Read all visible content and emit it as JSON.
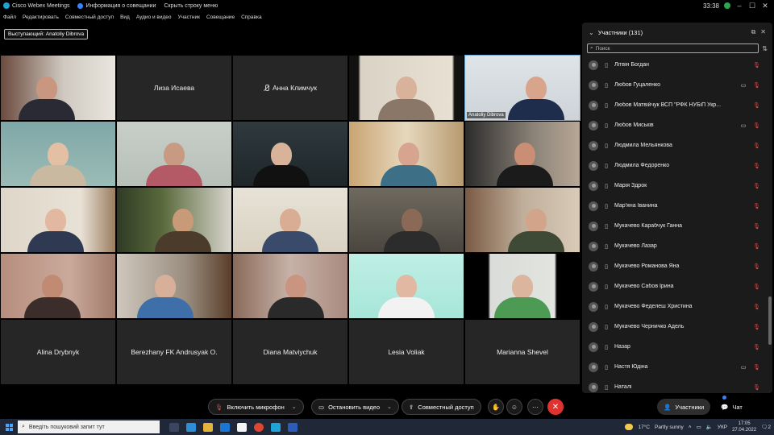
{
  "titlebar": {
    "app": "Cisco Webex Meetings",
    "info": "Информация о совещании",
    "hide": "Скрыть строку меню",
    "time": "33:38",
    "user_initial": "В"
  },
  "menu": [
    "Файл",
    "Редактировать",
    "Совместный доступ",
    "Вид",
    "Аудио и видео",
    "Участник",
    "Совещание",
    "Справка"
  ],
  "speaker": "Выступающий: Anatoliy Dibrova",
  "tiles": {
    "liza": "Лиза Исаева",
    "anna": "Анна Климчук",
    "anatoliy": "Anatoliy Dibrova",
    "alina": "Alina Drybnyk",
    "berezhany": "Berezhany FK Andrusyak O.",
    "diana": "Diana Matviychuk",
    "lesia": "Lesia Voliak",
    "marianna": "Marianna Shevel"
  },
  "panel": {
    "title": "Участники (131)",
    "search_placeholder": "Поиск",
    "participants": [
      {
        "name": "Літвін Богдан",
        "video": false
      },
      {
        "name": "Любов Гуцаленко",
        "video": true
      },
      {
        "name": "Любов Матвійчук ВСП \"РФК НУБіП Укр...",
        "video": false
      },
      {
        "name": "Любов Миськів",
        "video": true
      },
      {
        "name": "Людмила Мельянкова",
        "video": false
      },
      {
        "name": "Людмила Федоренко",
        "video": false
      },
      {
        "name": "Марія Здрок",
        "video": false
      },
      {
        "name": "Мар'яна Іванина",
        "video": false
      },
      {
        "name": "Мукачево Карабчук Ганна",
        "video": false
      },
      {
        "name": "Мукачево Лазар",
        "video": false
      },
      {
        "name": "Мукачево Романова Яна",
        "video": false
      },
      {
        "name": "Мукачево Сабов Ірина",
        "video": false
      },
      {
        "name": "Мукачево Феделеш Христина",
        "video": false
      },
      {
        "name": "Мукачево Черничко Адель",
        "video": false
      },
      {
        "name": "Назар",
        "video": false
      },
      {
        "name": "Настя Юдіна",
        "video": true
      },
      {
        "name": "Наталі",
        "video": false
      }
    ]
  },
  "controls": {
    "mic": "Включить микрофон",
    "video": "Остановить видео",
    "share": "Совместный доступ",
    "participants": "Участники",
    "chat": "Чат"
  },
  "taskbar": {
    "search": "Введіть пошуковий запит тут",
    "temp": "17°C",
    "weather": "Partly sunny",
    "lang": "УКР",
    "time": "17:05",
    "date": "27.04.2022",
    "notif": "2"
  },
  "colors": {
    "active_tile": "#6aa7d8",
    "end_call": "#e0322f",
    "muted": "#e24b4b"
  }
}
